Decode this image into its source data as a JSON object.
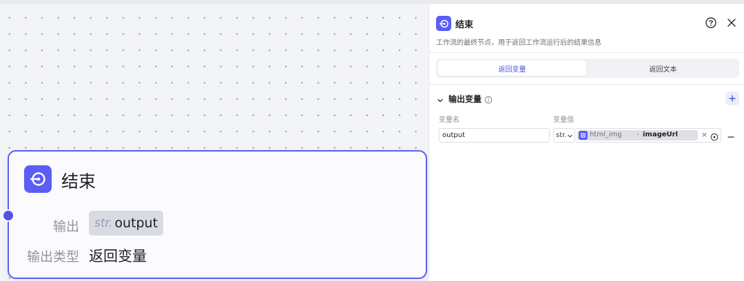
{
  "canvas": {
    "node": {
      "title": "结束",
      "icon": "end-node-icon",
      "output_label": "输出",
      "output_type": "str.",
      "output_name": "output",
      "output_mode_label": "输出类型",
      "output_mode_value": "返回变量"
    }
  },
  "panel": {
    "title": "结束",
    "icon": "end-node-icon",
    "description": "工作流的最终节点，用于返回工作流运行后的结果信息",
    "help_icon": "help-circle-icon",
    "close_icon": "close-icon",
    "tabs": [
      {
        "label": "返回变量",
        "active": true
      },
      {
        "label": "返回文本",
        "active": false
      }
    ],
    "section": {
      "title": "输出变量",
      "add_icon": "plus-icon",
      "info_icon": "info-icon",
      "col_name": "变量名",
      "col_value": "变量值"
    },
    "row": {
      "name": "output",
      "type": "str.",
      "ref_node": "html_img",
      "ref_separator": "-",
      "ref_field": "imageUrl",
      "clear_symbol": "×"
    }
  },
  "colors": {
    "accent": "#4d53e8",
    "node_icon_bg": "#5b5ef4",
    "node_border": "#5a5cf0"
  }
}
